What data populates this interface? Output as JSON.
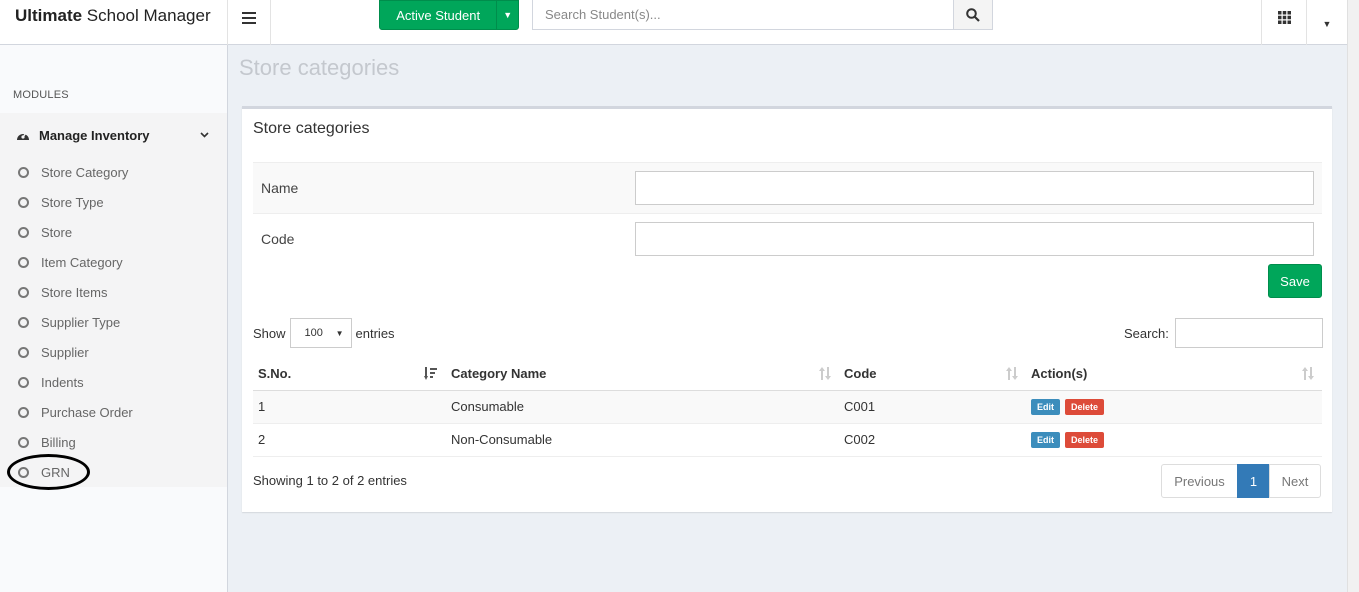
{
  "brand": {
    "bold": "Ultimate",
    "rest": " School Manager"
  },
  "topbar": {
    "active_student_label": "Active Student",
    "search_placeholder": "Search Student(s)..."
  },
  "sidebar": {
    "header": "MODULES",
    "parent_label": "Manage Inventory",
    "items": [
      {
        "label": "Store Category"
      },
      {
        "label": "Store Type"
      },
      {
        "label": "Store"
      },
      {
        "label": "Item Category"
      },
      {
        "label": "Store Items"
      },
      {
        "label": "Supplier Type"
      },
      {
        "label": "Supplier"
      },
      {
        "label": "Indents"
      },
      {
        "label": "Purchase Order"
      },
      {
        "label": "Billing"
      },
      {
        "label": "GRN"
      }
    ]
  },
  "page": {
    "title": "Store categories",
    "box_title": "Store categories",
    "form": {
      "name_label": "Name",
      "name_value": "",
      "code_label": "Code",
      "code_value": "",
      "save_label": "Save"
    },
    "table_controls": {
      "show_label": "Show",
      "entries_value": "100",
      "entries_label": "entries",
      "search_label": "Search:",
      "search_value": ""
    },
    "table": {
      "columns": [
        "S.No.",
        "Category Name",
        "Code",
        "Action(s)"
      ],
      "rows": [
        {
          "sno": "1",
          "name": "Consumable",
          "code": "C001"
        },
        {
          "sno": "2",
          "name": "Non-Consumable",
          "code": "C002"
        }
      ],
      "edit_label": "Edit",
      "delete_label": "Delete"
    },
    "info": "Showing 1 to 2 of 2 entries",
    "pagination": {
      "previous": "Previous",
      "current": "1",
      "next": "Next"
    }
  },
  "colors": {
    "success": "#00a65a",
    "primary": "#3c8dbc",
    "danger": "#dd4b39",
    "page_bg": "#ecf0f5"
  }
}
